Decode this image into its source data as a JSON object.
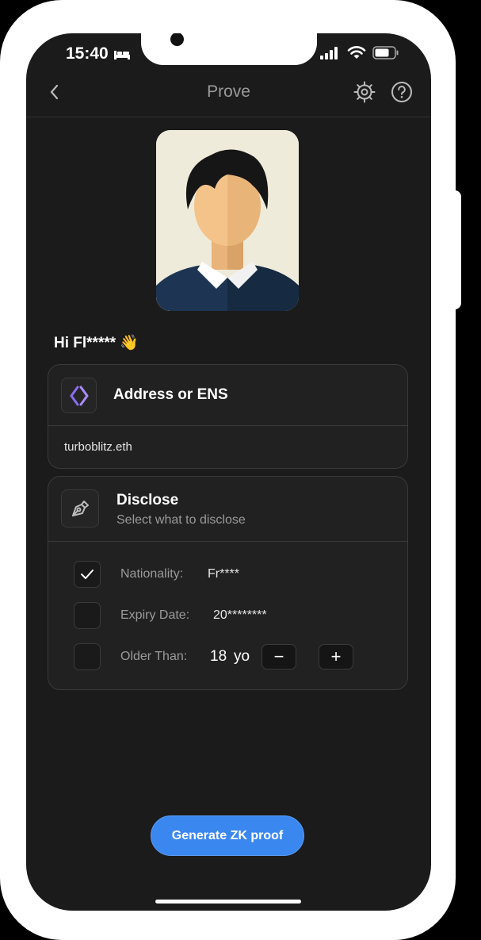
{
  "status_bar": {
    "time": "15:40",
    "icons": [
      "bed-icon",
      "signal-icon",
      "wifi-icon",
      "battery-icon"
    ]
  },
  "header": {
    "title": "Prove",
    "icons": [
      "back-icon",
      "gear-icon",
      "help-icon"
    ]
  },
  "greeting": "Hi Fl***** 👋",
  "address_card": {
    "title": "Address or ENS",
    "value": "turboblitz.eth",
    "icon": "ens-logo-icon"
  },
  "disclose_card": {
    "title": "Disclose",
    "subtitle": "Select what to disclose",
    "icon": "pen-nib-icon",
    "items": [
      {
        "label": "Nationality:",
        "value": "Fr****",
        "checked": true
      },
      {
        "label": "Expiry Date:",
        "value": "20********",
        "checked": false
      },
      {
        "label": "Older Than:",
        "value": "18",
        "unit": "yo",
        "checked": false
      }
    ],
    "stepper": {
      "minus": "−",
      "plus": "+"
    }
  },
  "cta": {
    "label": "Generate ZK proof"
  },
  "colors": {
    "accent": "#3b87f0",
    "background": "#1b1b1b",
    "card": "#212121",
    "ens_purple": "#8a6cf0"
  }
}
